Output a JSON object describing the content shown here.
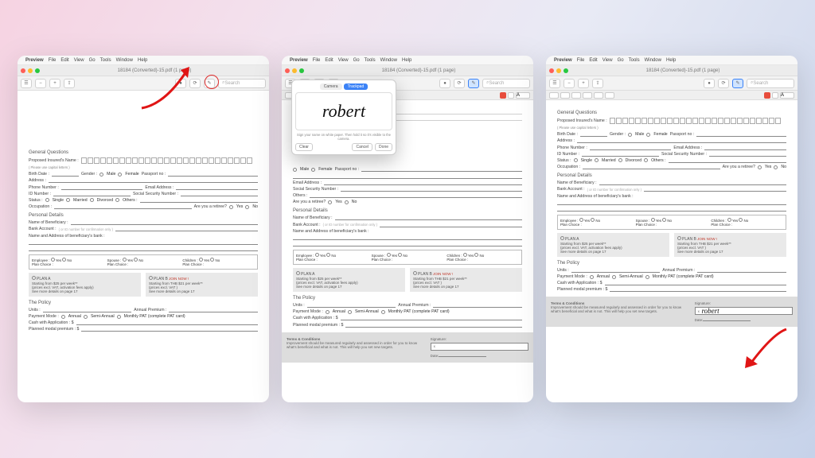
{
  "menu": {
    "app": "Preview",
    "items": [
      "File",
      "Edit",
      "View",
      "Go",
      "Tools",
      "Window",
      "Help"
    ]
  },
  "doc_title": "18184 (Converted)-15.pdf (1 page)",
  "search_placeholder": "Search",
  "sect_general": "General Questions",
  "proposed_label": "Proposed Insured's Name :",
  "proposed_note": "( Please use capital letters )",
  "birth_label": "Birth Date :",
  "gender_label": "Gender :",
  "male": "Male",
  "female": "Female",
  "passport_label": "Passport no :",
  "address_label": "Address :",
  "phone_label": "Phone Number :",
  "email_label": "Email Address :",
  "id_label": "ID Number :",
  "ssn_label": "Social Security  Number :",
  "status_label": "Status :",
  "s1": "Single",
  "s2": "Married",
  "s3": "Divorced",
  "s4": "Others :",
  "occupation_label": "Occupation :",
  "retiree_label": "Are you a retiree?",
  "yes": "Yes",
  "no": "No",
  "sect_personal": "Personal Details",
  "benef_label": "Name of Beneficiary :",
  "bank_label": "Bank Account :",
  "bank_note": "( or ID number for confirmation only )",
  "bank_addr_label": "Name and Address of beneficiary's bank :",
  "emp": "Employee :",
  "spouse": "Spouse :",
  "children": "Children :",
  "planchoice": "Plan Choice :",
  "planA_title": "PLAN A",
  "planA_l1": "Starting from $25 per week**",
  "planA_l2": "(prices excl. VAT, activation fees apply)",
  "planA_l3": "See more details on page 17",
  "planB_title": "PLAN B",
  "planB_join": "JOIN NOW !",
  "planB_l1": "Starting from THB $21 per week**",
  "planB_l2": "(prices excl. VAT )",
  "planB_l3": "See more details on page 17",
  "sect_policy": "The Policy",
  "units": "Units :",
  "annual": "Annual Premium :",
  "paymode": "Payment Mode :",
  "pm1": "Annual",
  "pm2": "Semi-Annual",
  "pm3": "Monthly PAT (complete PAT card)",
  "cash": "Cash with Application :  $",
  "planned": "Planned modal premium :  $",
  "terms_title": "Terms & Conditions",
  "terms_body": "Improvement should be measured regularly and assessed in order for you to know what's beneficial and what is not. This will help you set new targets.",
  "sig_label": "Signature:",
  "date_label": "Date:",
  "sig_x": "x",
  "signed_name": "robert",
  "popup": {
    "tab_camera": "Camera",
    "tab_trackpad": "Trackpad",
    "hint": "Sign your name on white paper. Then hold it so it's visible to the camera.",
    "clear": "Clear",
    "cancel": "Cancel",
    "done": "Done",
    "name": "robert"
  }
}
